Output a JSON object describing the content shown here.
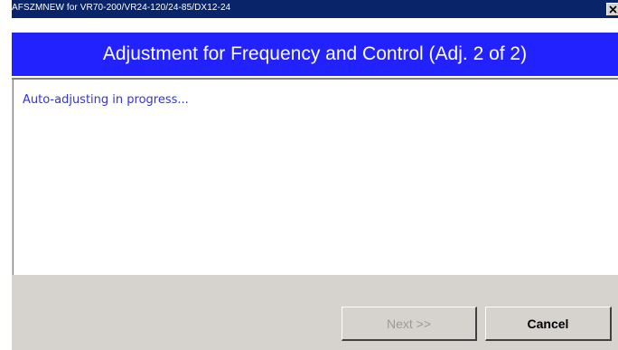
{
  "window": {
    "title": "AFSZMNEW for VR70-200/VR24-120/24-85/DX12-24",
    "close_icon": "close-icon"
  },
  "header": {
    "title": "Adjustment for Frequency and Control (Adj. 2 of 2)",
    "accent_color": "#2222ff"
  },
  "content": {
    "status_text": "Auto-adjusting in progress...",
    "status_color": "#3333dd"
  },
  "buttons": {
    "next_label": "Next >>",
    "next_enabled": false,
    "cancel_label": "Cancel"
  }
}
